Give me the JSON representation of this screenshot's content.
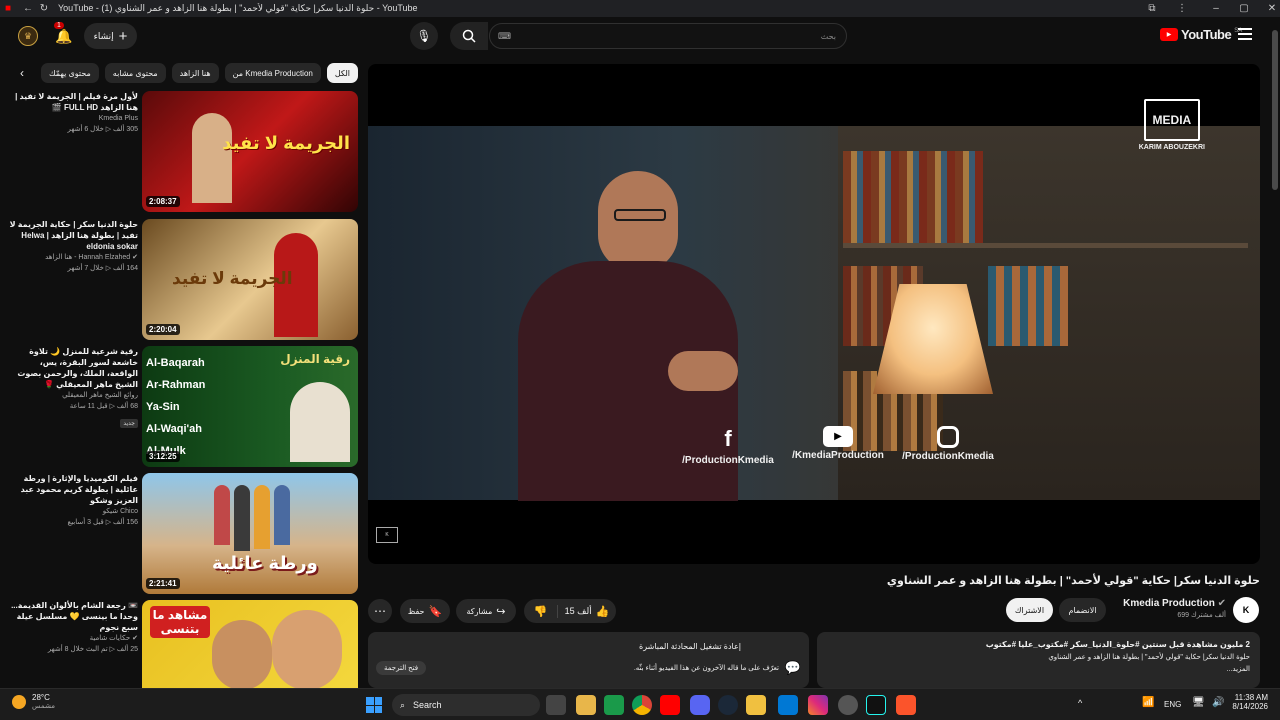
{
  "browser": {
    "tab_count": "(1)",
    "page_title": "YouTube - (1) حلوة الدنيا سكر| حكاية \"قولي لأحمد\" | بطولة هنا الزاهد و عمر الشناوي - YouTube"
  },
  "header": {
    "logo": "YouTube",
    "region": "SA",
    "search_placeholder": "بحث",
    "create_label": "إنشاء",
    "notif_count": "1"
  },
  "chips": [
    "الكل",
    "من Kmedia Production",
    "هنا الزاهد",
    "محتوى مشابه",
    "محتوى يهمّك"
  ],
  "recs": [
    {
      "title": "لأول مرة فيلم | الجريمة لا تفيد | هنا الزاهد FULL HD 🎬",
      "channel": "Kmedia Plus",
      "meta": "305 ألف ▷ خلال 6 أشهر",
      "duration": "2:08:37",
      "badge": "",
      "thumb_text": "الجريمة لا تفيد"
    },
    {
      "title": "حلوة الدنيا سكر | حكاية الجريمة لا تفيد | بطولة هنا الزاهد | Helwa eldonia sokar",
      "channel": "Hannah Elzahed - هنا الزاهد",
      "meta": "164 ألف ▷ خلال 7 أشهر",
      "duration": "2:20:04",
      "badge": "",
      "thumb_text": "الجريمة لا تفيد"
    },
    {
      "title": "رقية شرعية للمنزل 🌙 تلاوة خاشعة لسور البقرة، يس، الواقعة، الملك، والرحمن بصوت الشيخ ماهر المعيقلي 🌹",
      "channel": "روائع الشيخ ماهر المعيقلي",
      "meta": "68 ألف ▷ قبل 11 ساعة",
      "duration": "3:12:25",
      "badge": "جديد",
      "thumb_text": "رقية المنزل"
    },
    {
      "title": "فيلم الكوميديا والإثارة | ورطة عائلية | بطولة كريم محمود عبد العزيز وشكو",
      "channel": "Chico شيكو",
      "meta": "156 ألف ▷ قبل 3 أسابيع",
      "duration": "2:21:41",
      "badge": "",
      "thumb_text": "ورطة عائلية"
    },
    {
      "title": "📼 رجعة الشام بالألوان القديمة... وحدا ما بينسى 💛 مسلسل عيلة سبع نجوم",
      "channel": "حكايات شامية",
      "meta": "25 ألف ▷ تم البث خلال 8 أشهر",
      "duration": "",
      "badge": "",
      "thumb_text": "مشاهد ما بتنسى"
    }
  ],
  "video": {
    "title": "حلوة الدنيا سكر| حكاية \"قولي لأحمد\" | بطولة هنا الزاهد و عمر الشناوي",
    "brand": "MEDIA",
    "brand_sub": "KARIM ABOUZEKRI",
    "social": [
      "/ProductionKmedia",
      "/KmediaProduction",
      "/ProductionKmedia"
    ]
  },
  "channel": {
    "name": "Kmedia Production",
    "subs": "699 ألف مشترك",
    "join": "الانضمام",
    "subscribe": "الاشتراك"
  },
  "actions": {
    "likes": "15 ألف",
    "share": "مشاركة",
    "save": "حفظ"
  },
  "description": {
    "views": "2 مليون مشاهدة  قبل سنتين  #حلوة_الدنيا_سكر #مكتوب_عليا #مكتوب",
    "text": "حلوة الدنيا سكر| حكاية \"قولي لأحمد\" | بطولة هنا الزاهد و عمر الشناوي",
    "more": "...المزيد"
  },
  "live_chat": {
    "title": "إعادة تشغيل المحادثة المباشرة",
    "text": "تعرّف على ما قاله الآخرون عن هذا الفيديو أثناء بثّه.",
    "button": "فتح الترجمة"
  },
  "taskbar": {
    "temp": "28°C",
    "weather": "مشمس",
    "search": "Search",
    "lang": "ENG",
    "time": "11:38 AM",
    "date": "8/14/2026"
  }
}
